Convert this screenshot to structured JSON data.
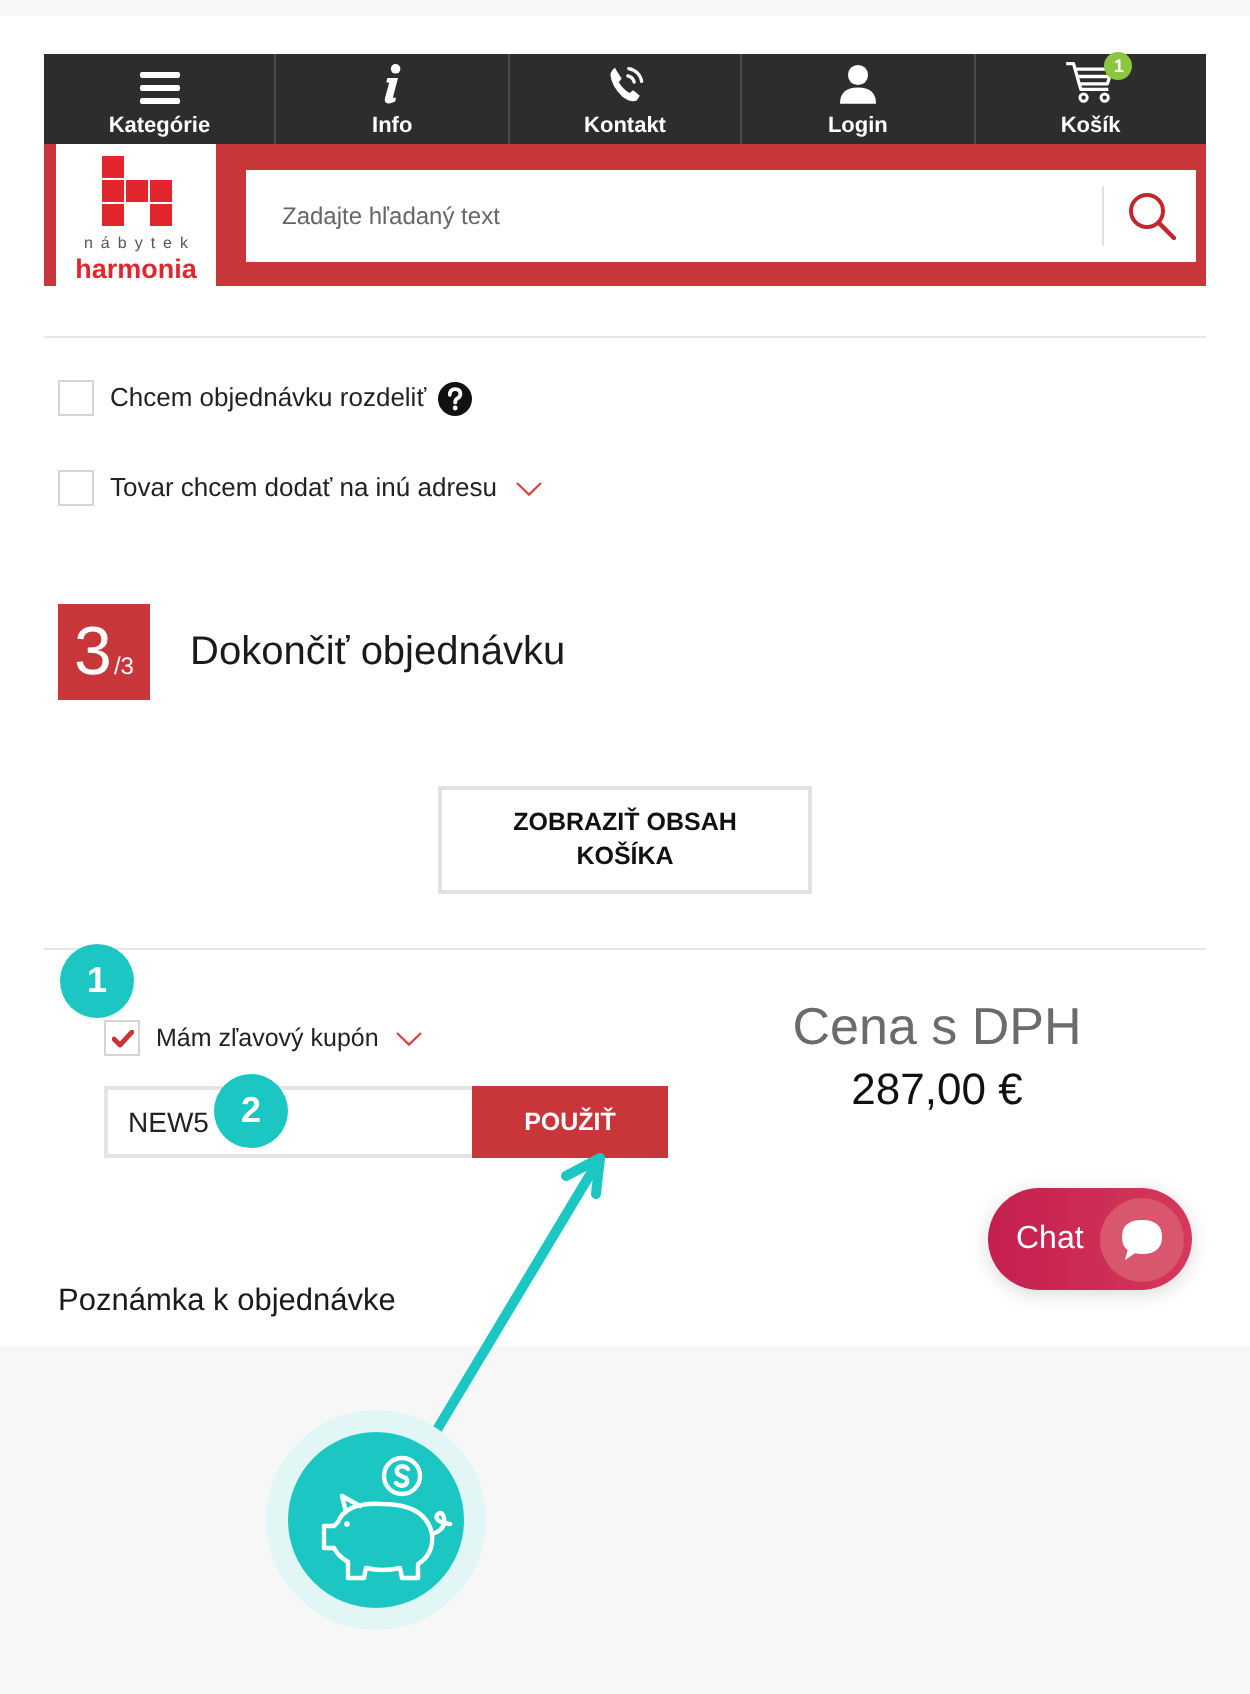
{
  "nav": {
    "items": [
      {
        "kind": "menu",
        "label": "Kategórie"
      },
      {
        "kind": "info",
        "label": "Info"
      },
      {
        "kind": "phone",
        "label": "Kontakt"
      },
      {
        "kind": "user",
        "label": "Login"
      },
      {
        "kind": "cart",
        "label": "Košík",
        "badge": "1"
      }
    ]
  },
  "logo": {
    "tagline": "nábytek",
    "wordmark": "harmonia"
  },
  "search": {
    "placeholder": "Zadajte hľadaný text"
  },
  "options": [
    {
      "kind": "help",
      "label": "Chcem objednávku rozdeliť",
      "checked": false
    },
    {
      "kind": "expand",
      "label": "Tovar chcem dodať na inú adresu",
      "checked": false
    }
  ],
  "step": {
    "number": "3",
    "total": "/3",
    "title": "Dokončiť objednávku"
  },
  "cart_button": {
    "label": "ZOBRAZIŤ OBSAH KOŠÍKA"
  },
  "coupon": {
    "label": "Mám zľavový kupón",
    "checked": true,
    "value": "NEW5",
    "apply_button": "POUŽIŤ"
  },
  "price": {
    "label": "Cena s DPH",
    "amount": "287,00 €"
  },
  "note": {
    "label": "Poznámka k objednávke"
  },
  "chat": {
    "label": "Chat"
  },
  "annotations": {
    "markers": [
      {
        "label": "1"
      },
      {
        "label": "2"
      }
    ]
  }
}
